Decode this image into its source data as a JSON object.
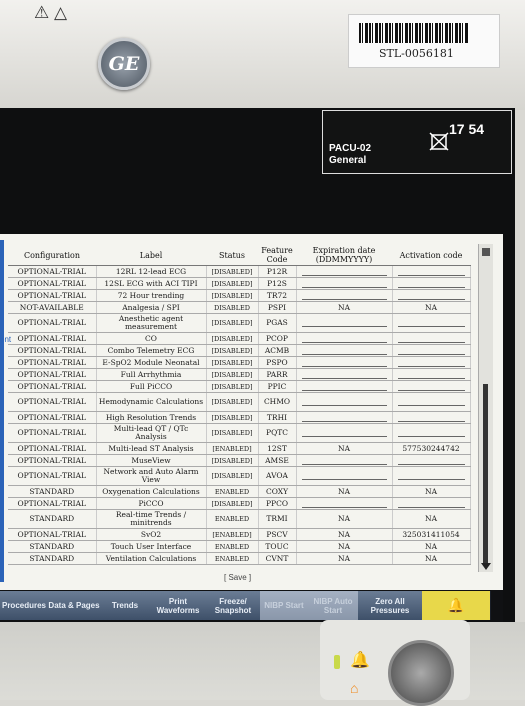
{
  "monitor": {
    "top_icons": "⚠ △",
    "logo": "GE",
    "asset_tag": "STL-0056181",
    "bed": "PACU-02",
    "department": "General",
    "time": "17 54"
  },
  "table": {
    "headers": [
      "Configuration",
      "Label",
      "Status",
      "Feature Code",
      "Expiration date (DDMMYYYY)",
      "Activation code"
    ],
    "rows": [
      {
        "config": "OPTIONAL-TRIAL",
        "label": "12RL 12-lead ECG",
        "status": "[DISABLED]",
        "code": "P12R",
        "exp": "",
        "act": ""
      },
      {
        "config": "OPTIONAL-TRIAL",
        "label": "12SL ECG with ACI TIPI",
        "status": "[DISABLED]",
        "code": "P12S",
        "exp": "",
        "act": ""
      },
      {
        "config": "OPTIONAL-TRIAL",
        "label": "72 Hour trending",
        "status": "[DISABLED]",
        "code": "TR72",
        "exp": "",
        "act": ""
      },
      {
        "config": "NOT-AVAILABLE",
        "label": "Analgesia / SPI",
        "status": "DISABLED",
        "code": "PSPI",
        "exp": "NA",
        "act": "NA"
      },
      {
        "config": "OPTIONAL-TRIAL",
        "label": "Anesthetic agent measurement",
        "status": "[DISABLED]",
        "code": "PGAS",
        "exp": "",
        "act": "",
        "tall": true
      },
      {
        "config": "OPTIONAL-TRIAL",
        "label": "CO",
        "status": "[DISABLED]",
        "code": "PCOP",
        "exp": "",
        "act": ""
      },
      {
        "config": "OPTIONAL-TRIAL",
        "label": "Combo Telemetry ECG",
        "status": "[DISABLED]",
        "code": "ACMB",
        "exp": "",
        "act": ""
      },
      {
        "config": "OPTIONAL-TRIAL",
        "label": "E-SpO2 Module Neonatal",
        "status": "[DISABLED]",
        "code": "PSPO",
        "exp": "",
        "act": ""
      },
      {
        "config": "OPTIONAL-TRIAL",
        "label": "Full Arrhythmia",
        "status": "[DISABLED]",
        "code": "PARR",
        "exp": "",
        "act": ""
      },
      {
        "config": "OPTIONAL-TRIAL",
        "label": "Full PiCCO",
        "status": "[DISABLED]",
        "code": "PPIC",
        "exp": "",
        "act": ""
      },
      {
        "config": "OPTIONAL-TRIAL",
        "label": "Hemodynamic Calculations",
        "status": "[DISABLED]",
        "code": "CHMO",
        "exp": "",
        "act": "",
        "tall": true
      },
      {
        "config": "OPTIONAL-TRIAL",
        "label": "High Resolution Trends",
        "status": "[DISABLED]",
        "code": "TRHI",
        "exp": "",
        "act": ""
      },
      {
        "config": "OPTIONAL-TRIAL",
        "label": "Multi-lead QT / QTc Analysis",
        "status": "[DISABLED]",
        "code": "PQTC",
        "exp": "",
        "act": "",
        "tall": true
      },
      {
        "config": "OPTIONAL-TRIAL",
        "label": "Multi-lead ST Analysis",
        "status": "[ENABLED]",
        "code": "12ST",
        "exp": "NA",
        "act": "577530244742"
      },
      {
        "config": "OPTIONAL-TRIAL",
        "label": "MuseView",
        "status": "[DISABLED]",
        "code": "AMSE",
        "exp": "",
        "act": ""
      },
      {
        "config": "OPTIONAL-TRIAL",
        "label": "Network and Auto Alarm View",
        "status": "[DISABLED]",
        "code": "AVOA",
        "exp": "",
        "act": "",
        "tall": true
      },
      {
        "config": "STANDARD",
        "label": "Oxygenation Calculations",
        "status": "ENABLED",
        "code": "COXY",
        "exp": "NA",
        "act": "NA"
      },
      {
        "config": "OPTIONAL-TRIAL",
        "label": "PiCCO",
        "status": "[DISABLED]",
        "code": "PPCO",
        "exp": "",
        "act": ""
      },
      {
        "config": "STANDARD",
        "label": "Real-time Trends / minitrends",
        "status": "ENABLED",
        "code": "TRMI",
        "exp": "NA",
        "act": "NA",
        "tall": true
      },
      {
        "config": "OPTIONAL-TRIAL",
        "label": "SvO2",
        "status": "[ENABLED]",
        "code": "PSCV",
        "exp": "NA",
        "act": "325031411054"
      },
      {
        "config": "STANDARD",
        "label": "Touch User Interface",
        "status": "ENABLED",
        "code": "TOUC",
        "exp": "NA",
        "act": "NA"
      },
      {
        "config": "STANDARD",
        "label": "Ventilation Calculations",
        "status": "ENABLED",
        "code": "CVNT",
        "exp": "NA",
        "act": "NA"
      }
    ]
  },
  "save_label": "[ Save ]",
  "side_text": "ont",
  "softkeys": [
    {
      "label": "Procedures",
      "enabled": true
    },
    {
      "label": "Data & Pages",
      "enabled": true
    },
    {
      "label": "Trends",
      "enabled": true
    },
    {
      "label": "Print Waveforms",
      "enabled": true
    },
    {
      "label": "Freeze/ Snapshot",
      "enabled": true
    },
    {
      "label": "NIBP Start",
      "enabled": false
    },
    {
      "label": "NIBP Auto Start",
      "enabled": false
    },
    {
      "label": "Zero All Pressures",
      "enabled": true
    }
  ],
  "alarm_key_icon": "bell-icon",
  "colors": {
    "accent": "#2b63b8",
    "softkey": "#4e6180",
    "alarm_key": "#e8d84a"
  }
}
